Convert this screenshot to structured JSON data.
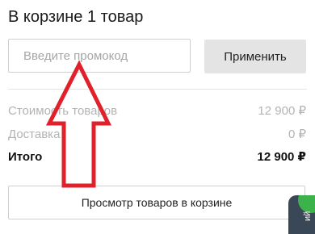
{
  "cart": {
    "title": "В корзине 1 товар"
  },
  "promo": {
    "placeholder": "Введите промокод",
    "value": "",
    "apply_label": "Применить"
  },
  "summary": {
    "goods_label": "Стоимость товаров",
    "goods_value": "12 900 ₽",
    "delivery_label": "Доставка",
    "delivery_value": "0 ₽",
    "total_label": "Итого",
    "total_value": "12 900 ₽"
  },
  "actions": {
    "view_cart_label": "Просмотр товаров в корзине"
  },
  "side_widget": {
    "text": "ий"
  },
  "annotation": {
    "arrow_color": "#e0202b",
    "arrow_icon": "arrow-up-icon"
  },
  "colors": {
    "muted_text": "#b3b3b3",
    "apply_button_bg": "#e4e4e4",
    "widget_bg": "#3a4756",
    "widget_accent": "#3cb34a"
  }
}
